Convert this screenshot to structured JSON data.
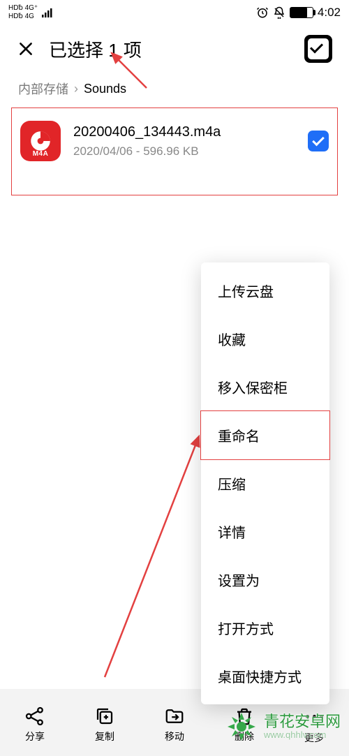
{
  "status": {
    "left_line1": "HD␢ 4G⁺",
    "left_line2": "HD␢ 4G",
    "time": "4:02"
  },
  "header": {
    "title": "已选择 1 项"
  },
  "breadcrumb": {
    "parent": "内部存储",
    "current": "Sounds"
  },
  "file": {
    "name": "20200406_134443.m4a",
    "subtitle": "2020/04/06 - 596.96 KB",
    "ext_label": "M4A",
    "selected": true
  },
  "popup": {
    "items": [
      {
        "label": "上传云盘"
      },
      {
        "label": "收藏"
      },
      {
        "label": "移入保密柜"
      },
      {
        "label": "重命名",
        "highlight": true
      },
      {
        "label": "压缩"
      },
      {
        "label": "详情"
      },
      {
        "label": "设置为"
      },
      {
        "label": "打开方式"
      },
      {
        "label": "桌面快捷方式"
      }
    ]
  },
  "bottom": {
    "share": "分享",
    "copy": "复制",
    "move": "移动",
    "delete": "删除",
    "more": "更多"
  },
  "watermark": {
    "title": "青花安卓网",
    "url": "www.qhhlv.com"
  }
}
